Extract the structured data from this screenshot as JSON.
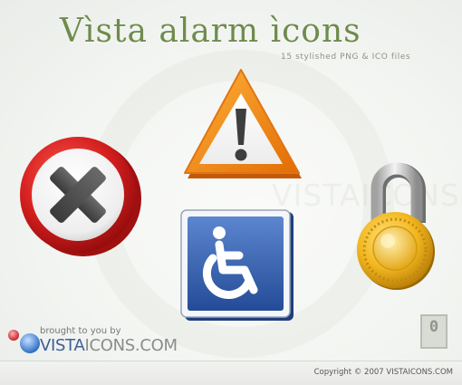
{
  "title": "Vìsta alarm ìcons",
  "subtitle": "15 stylished PNG & ICO files",
  "watermark": "VISTAICONS.COM",
  "brought_by": "brought to you by",
  "brand": {
    "part1": "VISTA",
    "part2": "ICONS.COM"
  },
  "copyright": "Copyright © 2007 VISTAICONS.COM",
  "rating_badge": "0",
  "icons": [
    {
      "name": "error-x-icon",
      "color": "#c81e1e"
    },
    {
      "name": "warning-triangle-icon",
      "color": "#f28a1a"
    },
    {
      "name": "accessibility-sign-icon",
      "color": "#2f5aa6"
    },
    {
      "name": "padlock-icon",
      "color": "#e5a913"
    }
  ]
}
